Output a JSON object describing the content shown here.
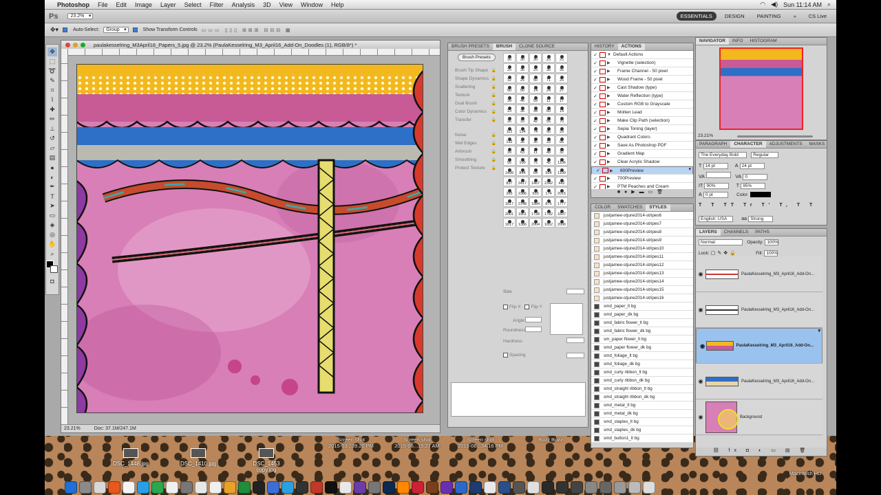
{
  "menubar": {
    "app": "Photoshop",
    "items": [
      "File",
      "Edit",
      "Image",
      "Layer",
      "Select",
      "Filter",
      "Analysis",
      "3D",
      "View",
      "Window",
      "Help"
    ],
    "clock": "Sun 11:14 AM"
  },
  "appbar": {
    "badge": "Ps",
    "zoom": "23.2%",
    "workspaces": [
      "ESSENTIALS",
      "DESIGN",
      "PAINTING"
    ],
    "cs_live": "CS Live"
  },
  "options": {
    "auto_select": "Auto-Select:",
    "auto_select_value": "Group",
    "transform": "Show Transform Controls"
  },
  "document": {
    "title": "paulakesselring_M3April16_Papers_5.jpg @ 23.2% (PaulaKesselring_M3_April16_Add-On_Doodles (1), RGB/8*) *",
    "zoom": "23.21%",
    "doc_size": "Doc: 37.1M/247.1M"
  },
  "brush_panel": {
    "tabs": [
      "BRUSH PRESETS",
      "BRUSH",
      "CLONE SOURCE"
    ],
    "presets_button": "Brush Presets",
    "options": [
      "Brush Tip Shape",
      "Shape Dynamics",
      "Scattering",
      "Texture",
      "Dual Brush",
      "Color Dynamics",
      "Transfer",
      "Noise",
      "Wet Edges",
      "Airbrush",
      "Smoothing",
      "Protect Texture"
    ],
    "sizes": [
      "30",
      "30",
      "30",
      "25",
      "25",
      "25",
      "36",
      "25",
      "36",
      "36",
      "32",
      "25",
      "50",
      "71",
      "25",
      "50",
      "50",
      "14",
      "24",
      "27",
      "39",
      "46",
      "59",
      "11",
      "17",
      "23",
      "36",
      "44",
      "60",
      "14",
      "26",
      "33",
      "42",
      "55",
      "70",
      "112",
      "134",
      "74",
      "95",
      "29",
      "192",
      "36",
      "36",
      "33",
      "66",
      "39",
      "63",
      "11",
      "48",
      "32",
      "55",
      "100",
      "75",
      "45",
      "1106",
      "1499",
      "844",
      "64",
      "564",
      "1109",
      "827",
      "2417",
      "1467",
      "2342",
      "442",
      "265",
      "2386",
      "933",
      "174",
      "2015",
      "1617",
      "2148",
      "1984",
      "875",
      "1777",
      "2001",
      "1901",
      "1728",
      "1782",
      "1607",
      "1617",
      "1386",
      "2004",
      "1652",
      "2006"
    ],
    "size_label": "Size",
    "flip_x": "Flip X",
    "flip_y": "Flip Y",
    "angle": "Angle:",
    "roundness": "Roundness:",
    "hardness": "Hardness",
    "spacing": "Spacing"
  },
  "actions_panel": {
    "tabs": [
      "HISTORY",
      "ACTIONS"
    ],
    "items": [
      "Default Actions",
      "Vignette (selection)",
      "Frame Channel - 50 pixel",
      "Wood Frame - 50 pixel",
      "Cast Shadow (type)",
      "Water Reflection (type)",
      "Custom RGB to Grayscale",
      "Molten Lead",
      "Make Clip Path (selection)",
      "Sepia Toning (layer)",
      "Quadrant Colors",
      "Save As Photoshop PDF",
      "Gradient Map",
      "Clear Acrylic Shadow",
      "600Preview",
      "700Preview",
      "PTM Peaches and Cream"
    ]
  },
  "styles_panel": {
    "tabs": [
      "COLOR",
      "SWATCHES",
      "STYLES"
    ],
    "items": [
      "justjamee-stjune2014-stripes6",
      "justjamee-stjune2014-stripes7",
      "justjamee-stjune2014-stripes8",
      "justjamee-stjune2014-stripes9",
      "justjamee-stjune2014-stripes10",
      "justjamee-stjune2014-stripes11",
      "justjamee-stjune2014-stripes12",
      "justjamee-stjune2014-stripes13",
      "justjamee-stjune2014-stripes14",
      "justjamee-stjune2014-stripes15",
      "justjamee-stjune2014-stripes16",
      "smd_paper_lt bg",
      "smd_paper_dk bg",
      "smd_fabric flower_lt bg",
      "smd_fabric flower_dk bg",
      "sm_paper flower_lt bg",
      "smd_paper flower_dk bg",
      "smd_foliage_lt bg",
      "smd_foliage_dk bg",
      "smd_curly ribbon_lt bg",
      "smd_curly ribbon_dk bg",
      "smd_straight ribbon_lt bg",
      "smd_straight ribbon_dk bg",
      "smd_metal_lt bg",
      "smd_metal_dk bg",
      "smd_staples_lt bg",
      "smd_staples_dk bg",
      "smd_button1_lt bg"
    ]
  },
  "navigator": {
    "tabs": [
      "NAVIGATOR",
      "INFO",
      "HISTOGRAM"
    ],
    "zoom": "23.21%"
  },
  "character": {
    "tabs": [
      "PARAGRAPH",
      "CHARACTER",
      "ADJUSTMENTS",
      "MASKS"
    ],
    "font": "The Everyday Bold",
    "style": "Regular",
    "size": "14 pt",
    "leading": "24 pt",
    "tracking": "0",
    "vscale": "90%",
    "hscale": "95%",
    "baseline": "0 pt",
    "color_label": "Color:",
    "language": "English: USA",
    "aa": "Strong"
  },
  "layers": {
    "tabs": [
      "LAYERS",
      "CHANNELS",
      "PATHS"
    ],
    "blend": "Normal",
    "opacity_label": "Opacity:",
    "opacity": "100%",
    "lock_label": "Lock:",
    "fill_label": "Fill:",
    "fill": "100%",
    "items": [
      {
        "name": "PaulaKesselring_M3_April16_Add-On...",
        "selected": false
      },
      {
        "name": "PaulaKesselring_M3_April16_Add-On...",
        "selected": false
      },
      {
        "name": "PaulaKesselring_M3_April16_Add-On...",
        "selected": true
      },
      {
        "name": "PaulaKesselring_M3_April16_Add-On...",
        "selected": false
      },
      {
        "name": "Background",
        "selected": false
      }
    ]
  },
  "desktop": {
    "files": [
      "DSC_1448.jpg",
      "DSC_1410.jpg",
      "DSC_1453 copy.jpg"
    ],
    "screenshots": [
      "Screen shot\n2015-03...39.20 PM",
      "Screen shot\n2015-06...15.27 AM",
      "Screen shot\n2015-06...34.16 PM"
    ],
    "buzz": "Buzz Buzz",
    "hd": "Macintosh HD"
  }
}
